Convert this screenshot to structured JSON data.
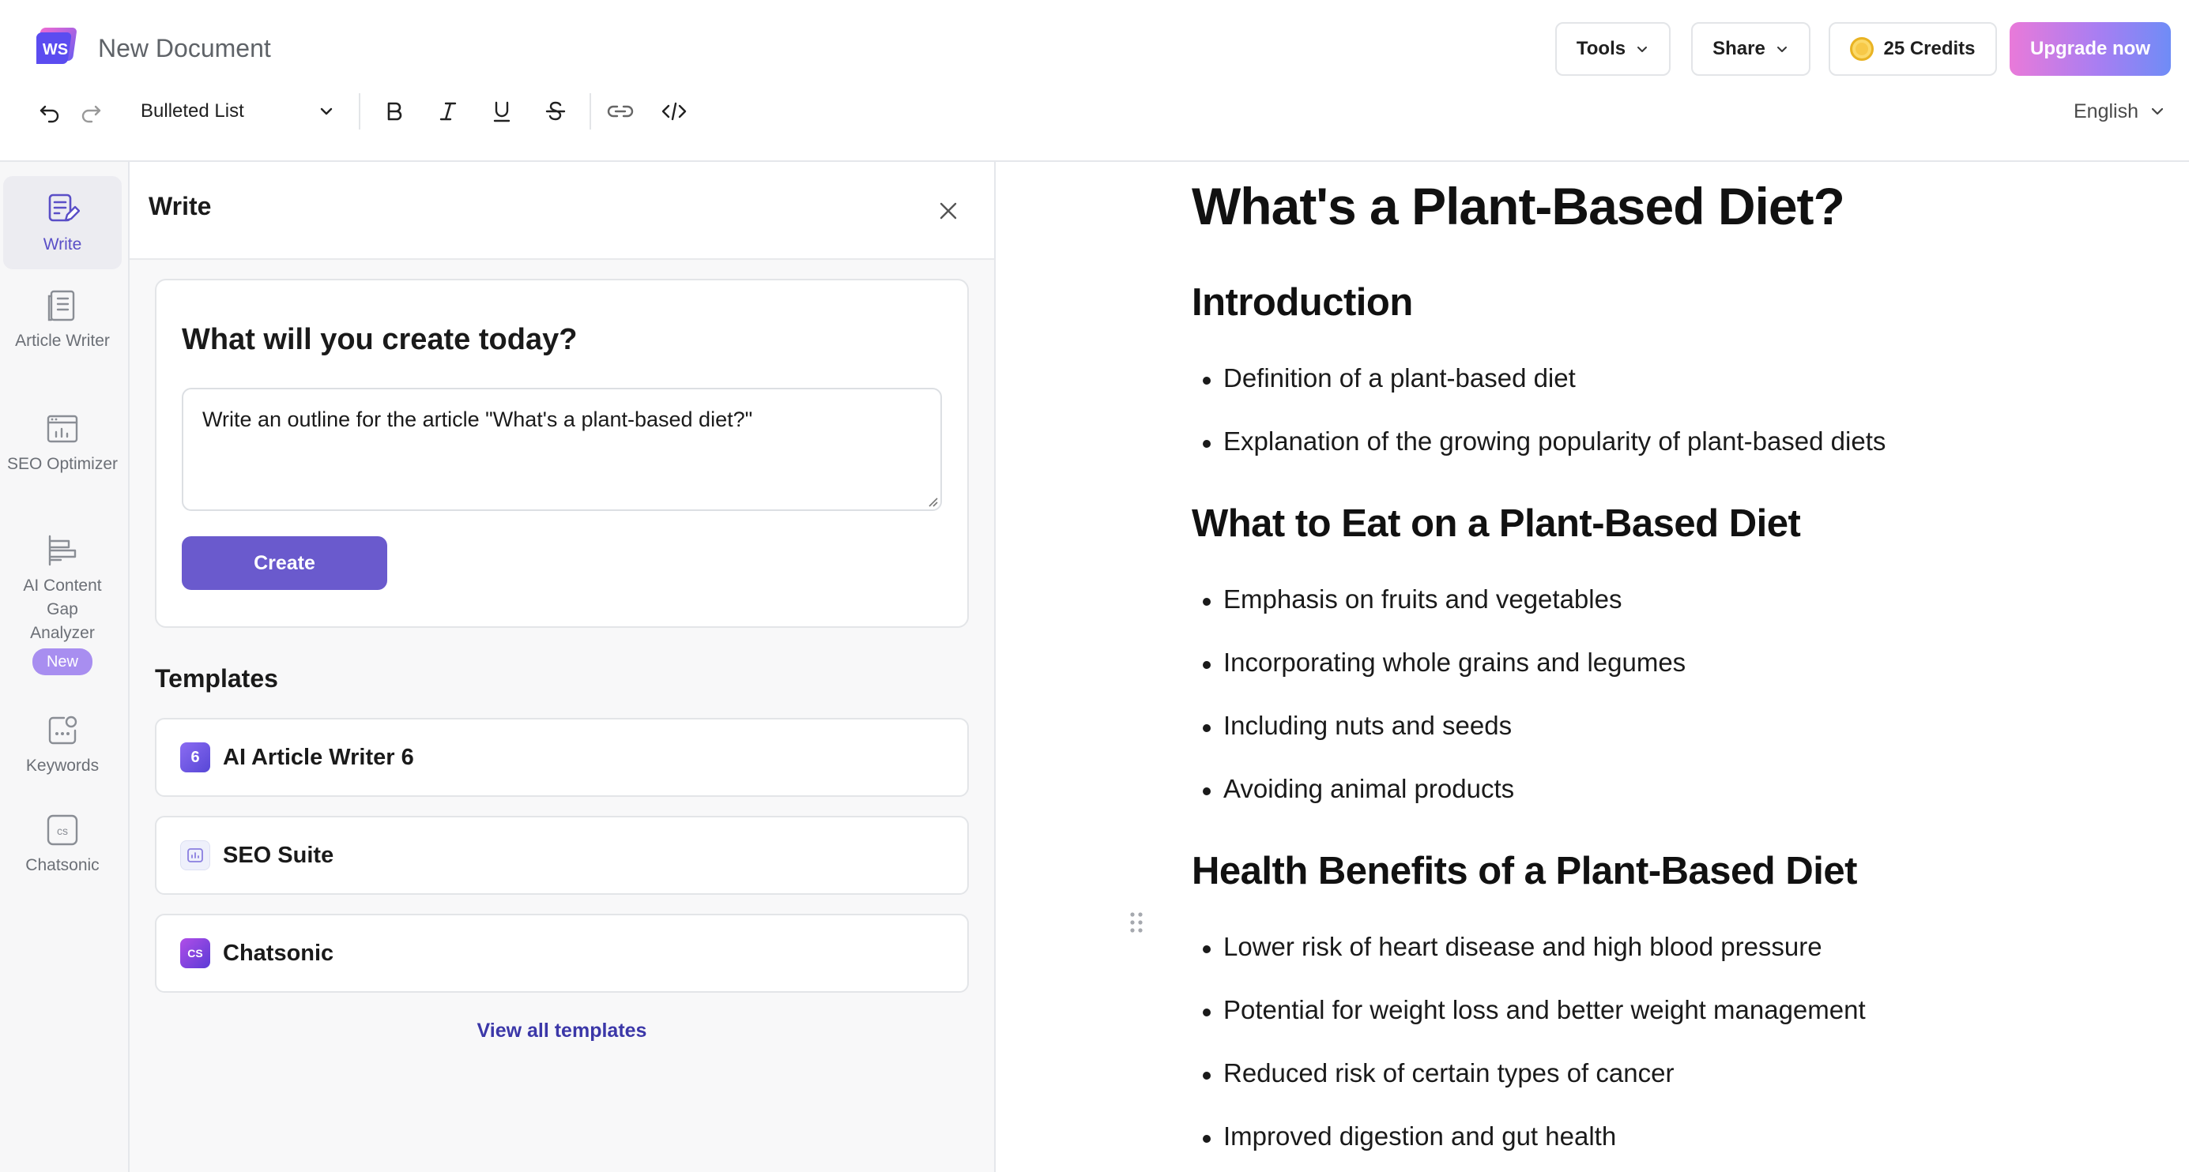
{
  "header": {
    "logo_text": "WS",
    "document_title": "New Document",
    "tools_label": "Tools",
    "share_label": "Share",
    "credits_label": "25 Credits",
    "upgrade_label": "Upgrade now"
  },
  "toolbar": {
    "block_type": "Bulleted List",
    "language": "English"
  },
  "rail": {
    "items": [
      {
        "label": "Write"
      },
      {
        "label": "Article Writer"
      },
      {
        "label": "SEO Optimizer"
      },
      {
        "label": "AI Content Gap Analyzer",
        "badge": "New"
      },
      {
        "label": "Keywords"
      },
      {
        "label": "Chatsonic"
      }
    ]
  },
  "panel": {
    "title": "Write",
    "card_title": "What will you create today?",
    "prompt_value": "Write an outline for the article \"What's a plant-based diet?\"",
    "create_label": "Create",
    "templates_heading": "Templates",
    "templates": [
      {
        "label": "AI Article Writer 6",
        "icon_text": "6"
      },
      {
        "label": "SEO Suite"
      },
      {
        "label": "Chatsonic",
        "icon_text": "CS"
      }
    ],
    "view_all_label": "View all templates"
  },
  "document": {
    "title": "What's a Plant-Based Diet?",
    "sections": [
      {
        "heading": "Introduction",
        "bullets": [
          "Definition of a plant-based diet",
          "Explanation of the growing popularity of plant-based diets"
        ]
      },
      {
        "heading": "What to Eat on a Plant-Based Diet",
        "bullets": [
          "Emphasis on fruits and vegetables",
          "Incorporating whole grains and legumes",
          "Including nuts and seeds",
          "Avoiding animal products"
        ]
      },
      {
        "heading": "Health Benefits of a Plant-Based Diet",
        "bullets": [
          "Lower risk of heart disease and high blood pressure",
          "Potential for weight loss and better weight management",
          "Reduced risk of certain types of cancer",
          "Improved digestion and gut health"
        ]
      }
    ]
  },
  "colors": {
    "accent": "#6a5acd",
    "rail_active": "#5a4fc7",
    "link": "#3b37a8",
    "upgrade_gradient_start": "#e97ad9",
    "upgrade_gradient_end": "#6f8cf6"
  }
}
